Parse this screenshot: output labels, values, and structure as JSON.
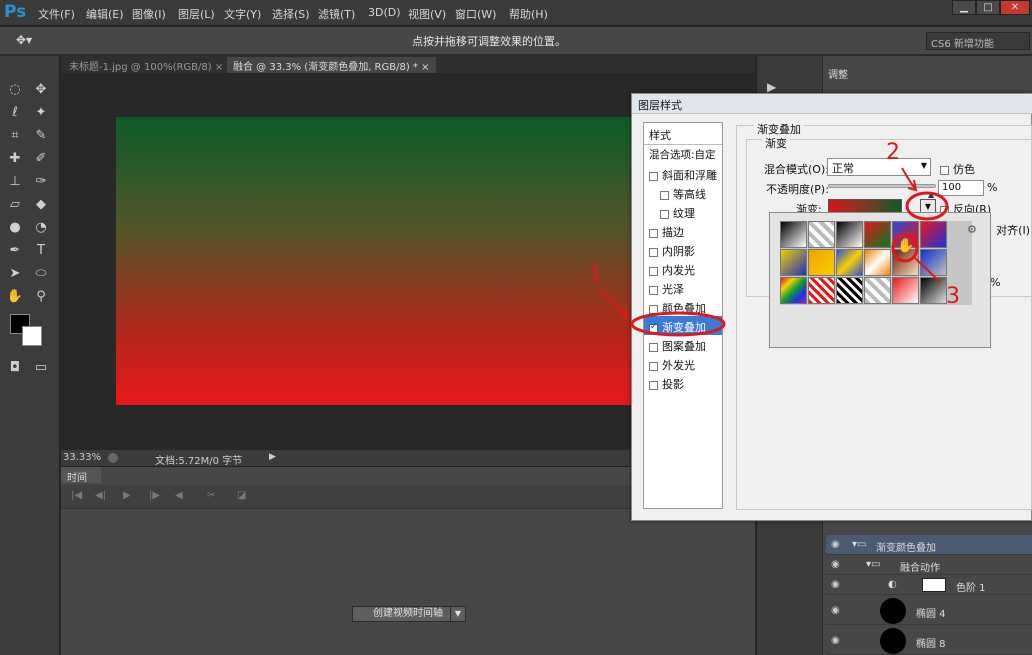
{
  "app": {
    "logo": "Ps"
  },
  "menu": [
    "文件(F)",
    "编辑(E)",
    "图像(I)",
    "图层(L)",
    "文字(Y)",
    "选择(S)",
    "滤镜(T)",
    "3D(D)",
    "视图(V)",
    "窗口(W)",
    "帮助(H)"
  ],
  "window_controls": {
    "minimize": "▁",
    "maximize": "□",
    "close": "✕"
  },
  "options_bar": {
    "hint": "点按并拖移可调整效果的位置。",
    "workspace": "CS6 新增功能"
  },
  "doc_tabs": [
    "未标题-1.jpg @ 100%(RGB/8) ×",
    "融合 @ 33.3% (渐变颜色叠加, RGB/8) * ×"
  ],
  "status": {
    "zoom": "33.33%",
    "doc": "文档:5.72M/0 字节"
  },
  "timeline": {
    "tab": "时间轴",
    "create_button": "创建视频时间轴"
  },
  "adjustments": {
    "tab": "调整"
  },
  "layers": [
    {
      "name": "渐变颜色叠加"
    },
    {
      "name": "融合动作"
    },
    {
      "name": "色阶 1"
    },
    {
      "name": "椭圆 4"
    },
    {
      "name": "椭圆 8"
    }
  ],
  "dialog": {
    "title": "图层样式",
    "styles_header": "样式",
    "blend_options": "混合选项:自定",
    "style_items": [
      {
        "label": "斜面和浮雕",
        "checked": false
      },
      {
        "label": "等高线",
        "checked": false
      },
      {
        "label": "纹理",
        "checked": false
      },
      {
        "label": "描边",
        "checked": false
      },
      {
        "label": "内阴影",
        "checked": false
      },
      {
        "label": "内发光",
        "checked": false
      },
      {
        "label": "光泽",
        "checked": false
      },
      {
        "label": "颜色叠加",
        "checked": false
      },
      {
        "label": "渐变叠加",
        "checked": true
      },
      {
        "label": "图案叠加",
        "checked": false
      },
      {
        "label": "外发光",
        "checked": false
      },
      {
        "label": "投影",
        "checked": false
      }
    ],
    "group_title": "渐变叠加",
    "sub_title": "渐变",
    "blend_mode_label": "混合模式(O):",
    "blend_mode_value": "正常",
    "dither_label": "仿色",
    "opacity_label": "不透明度(P):",
    "opacity_value": "100",
    "opacity_unit": "%",
    "gradient_label": "渐变:",
    "reverse_label": "反向(R)",
    "align_partial": "对齐(I)",
    "percent_partial": "%"
  },
  "annotations": [
    "1",
    "2",
    "3"
  ],
  "colors": {
    "canvas_top": "#0b5c27",
    "canvas_bottom": "#e8171b",
    "annotation": "#e01818"
  }
}
